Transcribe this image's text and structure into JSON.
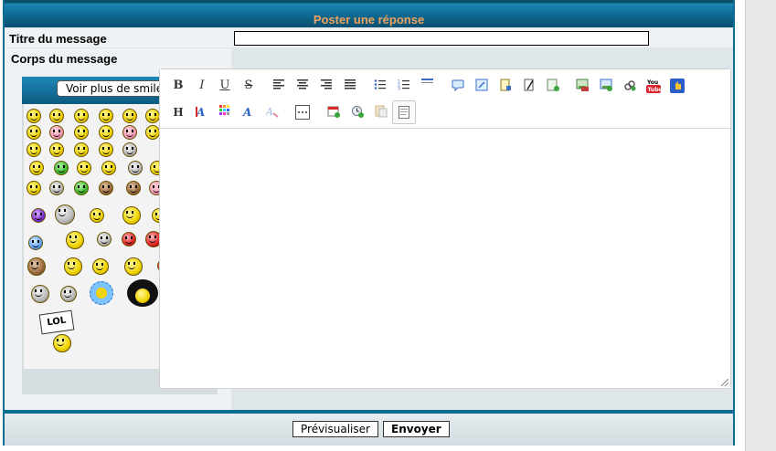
{
  "header": {
    "title": "Poster une réponse"
  },
  "form": {
    "title_label": "Titre du message",
    "title_value": "",
    "body_label": "Corps du message"
  },
  "smileys": {
    "more_button_label": "Voir plus de smileys"
  },
  "toolbar": {
    "row1": [
      "bold-icon",
      "italic-icon",
      "underline-icon",
      "strikethrough-icon",
      "align-left-icon",
      "align-center-icon",
      "align-right-icon",
      "align-justify-icon",
      "bullet-list-icon",
      "numbered-list-icon",
      "horizontal-rule-icon",
      "quote-icon",
      "code-icon",
      "spoiler-icon",
      "hide-icon",
      "insert-more-icon",
      "image-icon",
      "image-upload-icon",
      "link-icon",
      "youtube-icon",
      "dailymotion-icon"
    ],
    "row2": [
      "heading-icon",
      "text-color-icon",
      "color-grid-icon",
      "font-icon",
      "clear-format-icon",
      "more-options-icon",
      "date-icon",
      "time-icon",
      "paste-icon",
      "source-mode-icon"
    ],
    "bold_glyph": "B",
    "italic_glyph": "I",
    "underline_glyph": "U",
    "strike_glyph": "S",
    "heading_glyph": "H",
    "youtube_label": "You Tube",
    "lol_text": "LOL"
  },
  "footer": {
    "preview_label": "Prévisualiser",
    "send_label": "Envoyer"
  },
  "colors": {
    "header_blue": "#0e668f",
    "header_title": "#f0a35a",
    "frame_border": "#0b6d95"
  }
}
